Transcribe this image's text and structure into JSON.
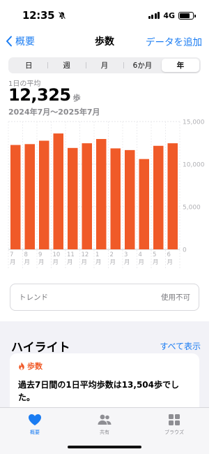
{
  "status": {
    "time": "12:35",
    "network": "4G"
  },
  "nav": {
    "back_label": "概要",
    "title": "歩数",
    "action_label": "データを追加"
  },
  "segments": [
    {
      "label": "日",
      "active": false
    },
    {
      "label": "週",
      "active": false
    },
    {
      "label": "月",
      "active": false
    },
    {
      "label": "6か月",
      "active": false
    },
    {
      "label": "年",
      "active": true
    }
  ],
  "summary": {
    "label": "1日の平均",
    "value": "12,325",
    "unit": "歩",
    "range": "2024年7月～2025年7月"
  },
  "chart_data": {
    "type": "bar",
    "categories": [
      "7月",
      "8月",
      "9月",
      "10月",
      "11月",
      "12月",
      "1月",
      "2月",
      "3月",
      "4月",
      "5月",
      "6月"
    ],
    "values": [
      12250,
      12350,
      12750,
      13600,
      11900,
      12450,
      12950,
      11850,
      11650,
      10600,
      12150,
      12450
    ],
    "ylim": [
      0,
      15000
    ],
    "y_ticks": [
      "0",
      "5,000",
      "10,000",
      "15,000"
    ],
    "bar_color": "#f05a28",
    "grid": true
  },
  "trend": {
    "label": "トレンド",
    "value": "使用不可"
  },
  "highlights": {
    "title": "ハイライト",
    "link_label": "すべて表示",
    "card": {
      "category": "歩数",
      "icon": "flame-icon",
      "text": "過去7日間の1日平均歩数は13,504歩でした。"
    }
  },
  "tabs": [
    {
      "label": "概要",
      "icon": "heart-icon",
      "active": true
    },
    {
      "label": "共有",
      "icon": "people-icon",
      "active": false
    },
    {
      "label": "ブラウズ",
      "icon": "grid-icon",
      "active": false
    }
  ],
  "colors": {
    "accent": "#1a7cf2",
    "steps": "#f05a28"
  }
}
